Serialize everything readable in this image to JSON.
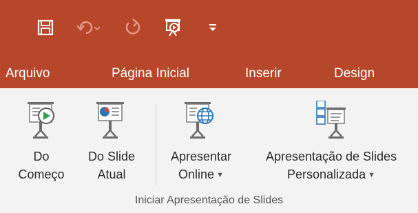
{
  "colors": {
    "accent": "#b7472a",
    "ribbon_bg": "#f3f3f3",
    "text": "#2b2b2b"
  },
  "quick_access": [
    {
      "name": "save-icon"
    },
    {
      "name": "undo-icon"
    },
    {
      "name": "redo-icon"
    },
    {
      "name": "start-from-beginning-icon"
    },
    {
      "name": "customize-quick-access-icon"
    }
  ],
  "tabs": [
    {
      "label": "Arquivo"
    },
    {
      "label": "Página Inicial"
    },
    {
      "label": "Inserir"
    },
    {
      "label": "Design"
    }
  ],
  "ribbon": {
    "buttons": [
      {
        "line1": "Do",
        "line2": "Começo",
        "icon": "play-from-start-icon"
      },
      {
        "line1": "Do Slide",
        "line2": "Atual",
        "icon": "play-from-current-slide-icon"
      },
      {
        "line1": "Apresentar",
        "line2": "Online",
        "icon": "present-online-icon",
        "dropdown": true
      },
      {
        "line1": "Apresentação de Slides",
        "line2": "Personalizada",
        "icon": "custom-slide-show-icon",
        "dropdown": true
      }
    ],
    "group_label": "Iniciar Apresentação de Slides"
  }
}
